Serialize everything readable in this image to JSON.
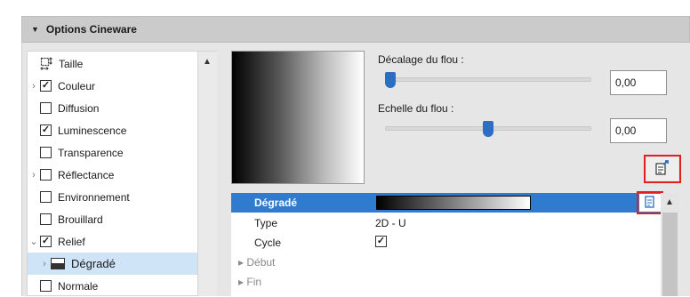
{
  "header": {
    "title": "Options Cineware"
  },
  "tree": {
    "items": [
      {
        "label": "Taille",
        "icon": "size-icon",
        "expander": "",
        "checked": null
      },
      {
        "label": "Couleur",
        "expander": ">",
        "checked": true
      },
      {
        "label": "Diffusion",
        "expander": "",
        "checked": false
      },
      {
        "label": "Luminescence",
        "expander": "",
        "checked": true
      },
      {
        "label": "Transparence",
        "expander": "",
        "checked": false
      },
      {
        "label": "Réflectance",
        "expander": ">",
        "checked": false
      },
      {
        "label": "Environnement",
        "expander": "",
        "checked": false
      },
      {
        "label": "Brouillard",
        "expander": "",
        "checked": false
      },
      {
        "label": "Relief",
        "expander": "v",
        "checked": true
      },
      {
        "label": "Dégradé",
        "expander": ">",
        "icon": "gradient-icon",
        "selected": true
      },
      {
        "label": "Normale",
        "expander": "",
        "checked": false
      }
    ]
  },
  "blur": {
    "offset_label": "Décalage du flou :",
    "offset_value": "0,00",
    "offset_slider_fraction": 0.0,
    "scale_label": "Echelle du flou :",
    "scale_value": "0,00",
    "scale_slider_fraction": 0.5
  },
  "properties": {
    "header_label": "Dégradé",
    "type_label": "Type",
    "type_value": "2D - U",
    "cycle_label": "Cycle",
    "cycle_checked": true,
    "start_label": "Début",
    "end_label": "Fin"
  },
  "colors": {
    "accent": "#2f7bd0",
    "highlight": "#e0211d",
    "selection": "#cfe4f7"
  }
}
